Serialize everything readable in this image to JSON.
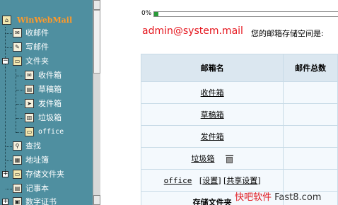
{
  "sidebar": {
    "brand": "WinWebMail",
    "items": [
      {
        "label": "收邮件",
        "icon": "inbox-icon"
      },
      {
        "label": "写邮件",
        "icon": "compose-icon"
      },
      {
        "label": "文件夹",
        "icon": "folder-icon",
        "expander": "−"
      },
      {
        "label": "收件箱",
        "icon": "inbox-folder-icon"
      },
      {
        "label": "草稿箱",
        "icon": "drafts-icon"
      },
      {
        "label": "发件箱",
        "icon": "outbox-icon"
      },
      {
        "label": "垃圾箱",
        "icon": "trash-icon"
      },
      {
        "label": "office",
        "icon": "folder-icon"
      },
      {
        "label": "查找",
        "icon": "search-icon"
      },
      {
        "label": "地址簿",
        "icon": "addressbook-icon"
      },
      {
        "label": "存储文件夹",
        "icon": "storage-folder-icon",
        "expander": "+"
      },
      {
        "label": "记事本",
        "icon": "notepad-icon"
      },
      {
        "label": "数字证书",
        "icon": "certificate-icon",
        "expander": "+"
      }
    ]
  },
  "header": {
    "progress_text": "0%",
    "progress_value": 0.02,
    "account": "admin@system.mail",
    "quota_text": "您的邮箱存储空间是:"
  },
  "table": {
    "headers": [
      "邮箱名",
      "邮件总数"
    ],
    "rows": [
      {
        "name": "收件箱"
      },
      {
        "name": "草稿箱"
      },
      {
        "name": "发件箱"
      },
      {
        "name": "垃圾箱"
      },
      {
        "name": "office",
        "settings": "设置",
        "share": "共享设置"
      },
      {
        "name": "存储文件夹"
      }
    ]
  },
  "watermark": {
    "part1": "快吧软件",
    "part2": " Fast8.com"
  },
  "colors": {
    "sidebar": "#4F8FA0",
    "brand": "#ff9a2a",
    "account": "#e5141c",
    "header_bg": "#dbe7f0"
  }
}
